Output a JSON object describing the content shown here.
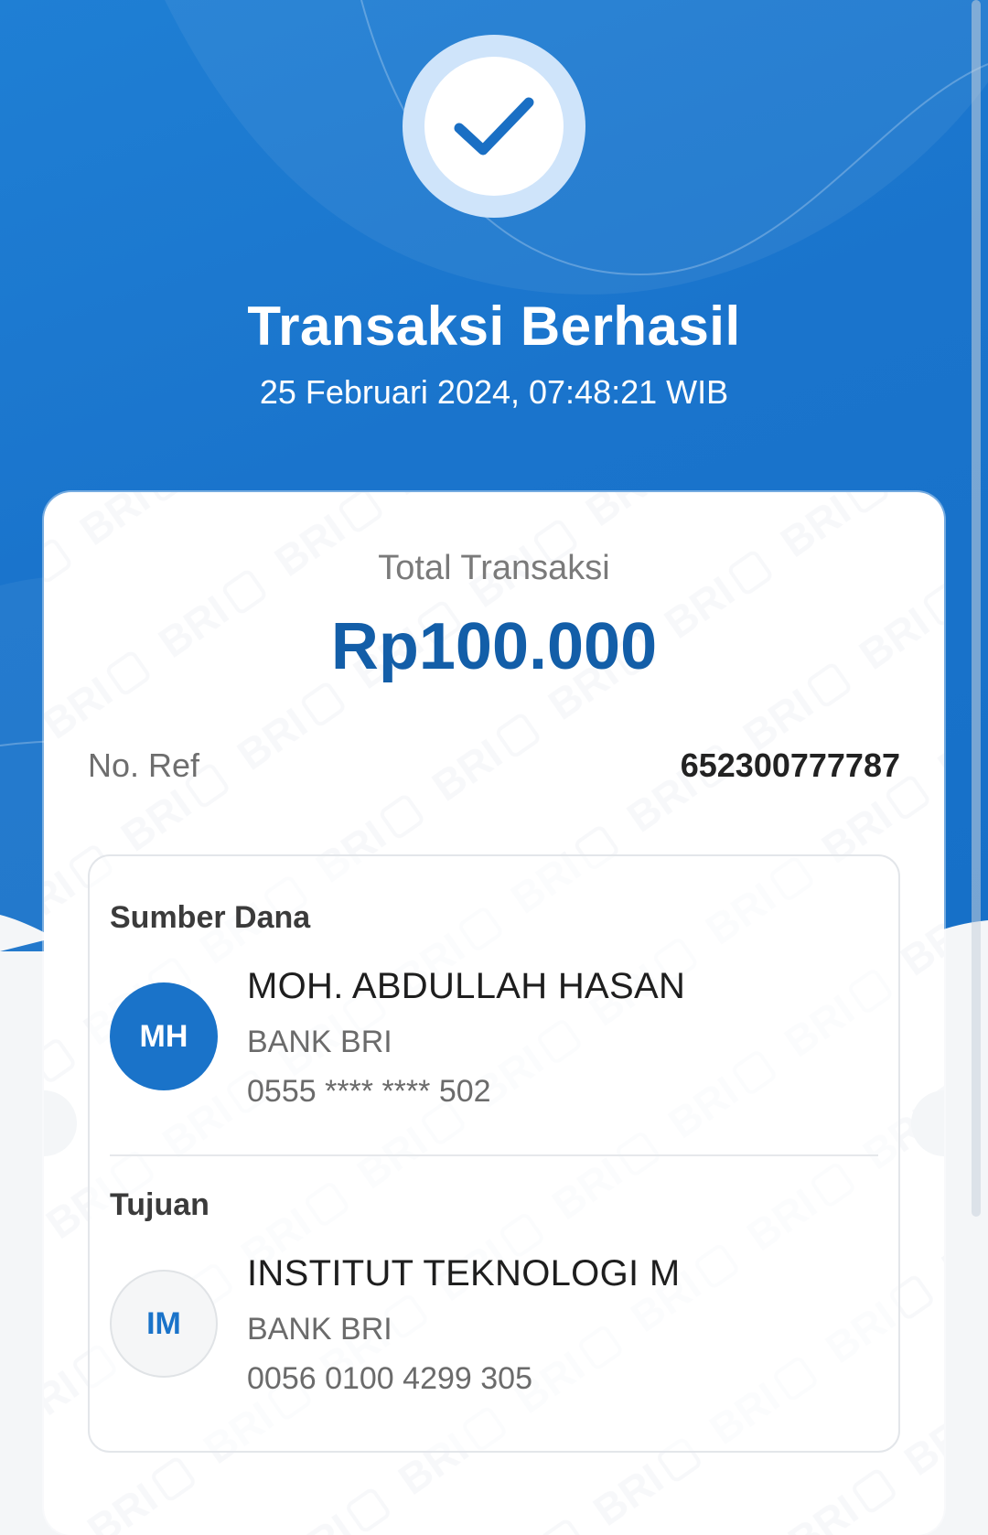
{
  "header": {
    "status_icon": "checkmark-icon",
    "title": "Transaksi Berhasil",
    "datetime": "25 Februari 2024, 07:48:21 WIB"
  },
  "receipt": {
    "watermark_text": "BRI",
    "total_label": "Total Transaksi",
    "total_amount": "Rp100.000",
    "ref_label": "No. Ref",
    "ref_value": "652300777787",
    "source": {
      "section_title": "Sumber Dana",
      "initials": "MH",
      "name": "MOH. ABDULLAH HASAN",
      "bank": "BANK BRI",
      "account": "0555 **** **** 502"
    },
    "destination": {
      "section_title": "Tujuan",
      "initials": "IM",
      "name": "INSTITUT TEKNOLOGI M",
      "bank": "BANK BRI",
      "account": "0056 0100 4299 305"
    }
  },
  "colors": {
    "primary_blue": "#1a74cc",
    "amount_blue": "#135ea8",
    "badge_light": "#cfe4fa"
  }
}
